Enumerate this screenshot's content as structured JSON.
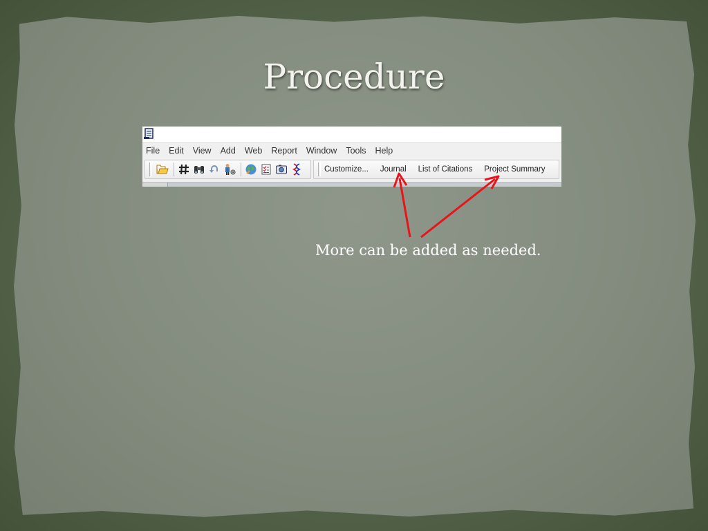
{
  "slide": {
    "title": "Procedure",
    "note": "More can be added as needed."
  },
  "app": {
    "menu": [
      "File",
      "Edit",
      "View",
      "Add",
      "Web",
      "Report",
      "Window",
      "Tools",
      "Help"
    ],
    "toolbar_buttons": [
      "Customize...",
      "Journal",
      "List of Citations",
      "Project Summary"
    ],
    "icons": [
      "open-folder-icon",
      "hash-icon",
      "binoculars-icon",
      "undo-icon",
      "add-person-icon",
      "globe-icon",
      "checklist-icon",
      "camera-icon",
      "dna-icon"
    ]
  },
  "colors": {
    "arrow": "#e8141a",
    "title_text": "#f4f4ef",
    "paper": "#8e978a"
  }
}
